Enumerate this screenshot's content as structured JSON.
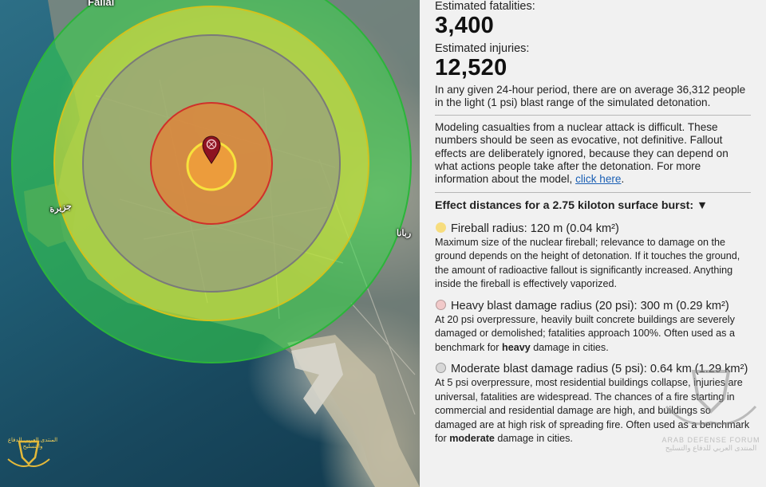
{
  "map": {
    "label_top": "Fallal",
    "label_left": "جزيرة",
    "label_right": "ربانا",
    "marker_icon": "location-pin-icon",
    "colors": {
      "fireball": "#f4d23a",
      "heavy": "#e0302b",
      "moderate": "#9a9a9a",
      "thermal": "#f0e83a",
      "light": "#2ecc40"
    }
  },
  "stats": {
    "fatalities_label": "Estimated fatalities:",
    "fatalities_value": "3,400",
    "injuries_label": "Estimated injuries:",
    "injuries_value": "12,520",
    "population_note": "In any given 24-hour period, there are on average 36,312 people in the light (1 psi) blast range of the simulated detonation."
  },
  "disclaimer": {
    "text": "Modeling casualties from a nuclear attack is difficult. These numbers should be seen as evocative, not definitive. Fallout effects are deliberately ignored, because they can depend on what actions people take after the detonation. For more information about the model,",
    "link": "click here",
    "end": "."
  },
  "effects": {
    "header": "Effect distances for a 2.75 kiloton surface burst",
    "header_colon": ":",
    "toggle_icon": "▼",
    "items": [
      {
        "title": "Fireball radius: 120 m (0.04 km²)",
        "swatch": "#f7dd7e",
        "desc_parts": [
          "Maximum size of the nuclear fireball; relevance to damage on the ground depends on the height of detonation. If it touches the ground, the amount of radioactive fallout is significantly increased. Anything inside the fireball is effectively vaporized."
        ]
      },
      {
        "title": "Heavy blast damage radius (20 psi): 300 m (0.29 km²)",
        "swatch": "#f1c9c9",
        "desc_before": "At 20 psi overpressure, heavily built concrete buildings are severely damaged or demolished; fatalities approach 100%. Often used as a benchmark for ",
        "desc_bold": "heavy",
        "desc_after": " damage in cities."
      },
      {
        "title": "Moderate blast damage radius (5 psi): 0.64 km (1.29 km²)",
        "swatch": "#d7d7d7",
        "desc_before": "At 5 psi overpressure, most residential buildings collapse, injuries are universal, fatalities are widespread. The chances of a fire starting in commercial and residential damage are high, and buildings so damaged are at high risk of spreading fire. Often used as a benchmark for ",
        "desc_bold": "moderate",
        "desc_after": " damage in cities."
      }
    ]
  },
  "watermark": {
    "left_text": "المنتدى العربي للدفاع والتسليح",
    "right_text_en": "ARAB DEFENSE FORUM",
    "right_text_ar": "المنتدى العربي للدفاع والتسليح"
  }
}
